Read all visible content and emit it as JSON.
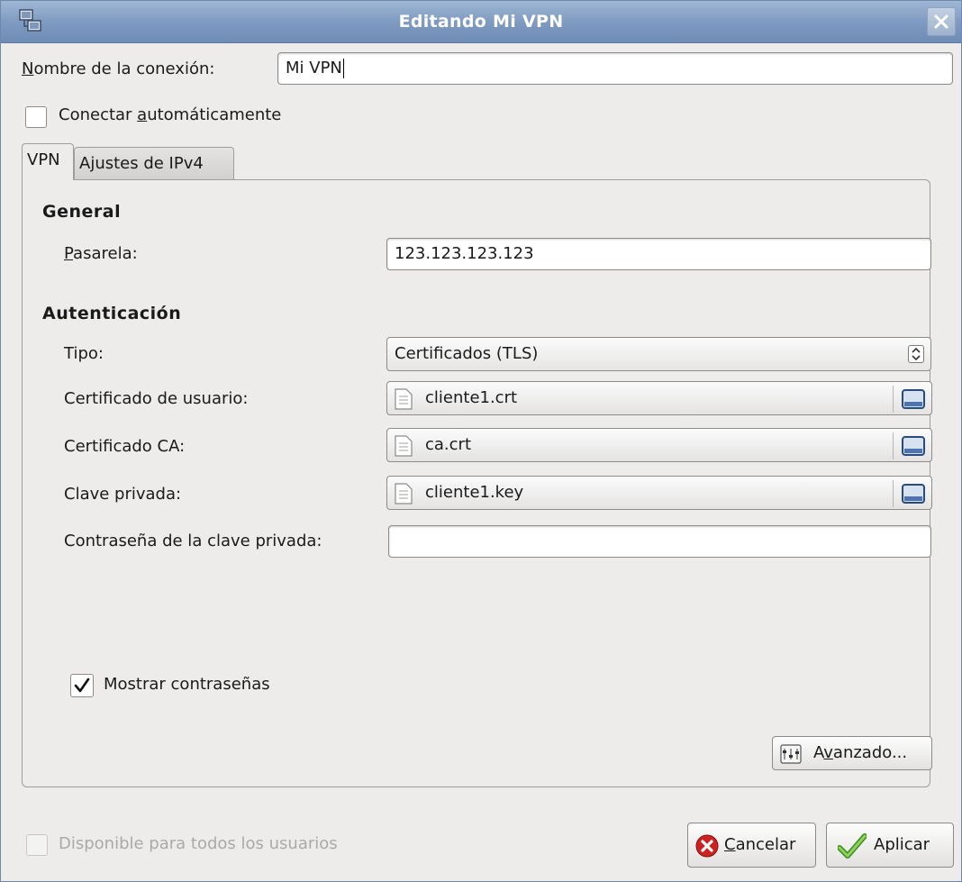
{
  "window": {
    "title": "Editando Mi VPN",
    "icon": "network-connection-icon",
    "close_icon": "close-icon"
  },
  "connection": {
    "name_label_mnemonic": "N",
    "name_label_rest": "ombre de la conexión:",
    "name_value": "Mi VPN",
    "autoconnect_label_pre": "Conectar ",
    "autoconnect_label_mnemonic": "a",
    "autoconnect_label_post": "utomáticamente",
    "autoconnect_checked": false
  },
  "tabs": [
    {
      "label": "VPN",
      "active": true
    },
    {
      "label": "Ajustes de IPv4",
      "active": false
    }
  ],
  "vpn": {
    "general_heading": "General",
    "gateway_label_mnemonic": "P",
    "gateway_label_rest": "asarela:",
    "gateway_value": "123.123.123.123",
    "auth_heading": "Autenticación",
    "type_label": "Tipo:",
    "type_value": "Certificados (TLS)",
    "user_cert_label": "Certificado de usuario:",
    "user_cert_value": "cliente1.crt",
    "ca_cert_label": "Certificado CA:",
    "ca_cert_value": "ca.crt",
    "private_key_label": "Clave privada:",
    "private_key_value": "cliente1.key",
    "key_password_label": "Contraseña de la clave privada:",
    "key_password_value": "",
    "show_passwords_label": "Mostrar contraseñas",
    "show_passwords_checked": true,
    "advanced_label_pre": "A",
    "advanced_label_mnemonic": "v",
    "advanced_label_post": "anzado...",
    "file_icon": "text-file-icon",
    "browse_icon": "folder-browse-icon"
  },
  "footer": {
    "all_users_label": "Disponible para todos los usuarios",
    "all_users_enabled": false,
    "cancel_mnemonic": "C",
    "cancel_rest": "ancelar",
    "apply_label": "Aplicar"
  },
  "colors": {
    "titlebar": "#7d99c0",
    "dialog_bg": "#edeceb",
    "cancel_icon": "#cc2222",
    "apply_icon": "#58a629"
  }
}
